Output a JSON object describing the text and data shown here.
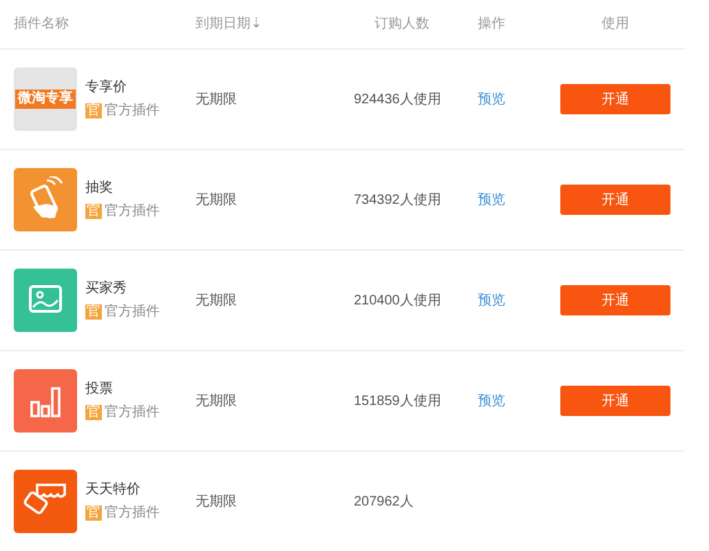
{
  "columns": [
    {
      "label": "插件名称"
    },
    {
      "label": "到期日期",
      "sort_arrow": "⇣"
    },
    {
      "label": "订购人数"
    },
    {
      "label": "操作"
    },
    {
      "label": "使用"
    }
  ],
  "rows": [
    {
      "kind": "banner",
      "banner_text": "微淘专享",
      "name": "专享价",
      "tag": "官",
      "tag_label": "官方插件",
      "expiry": "无期限",
      "count": "924436人使用",
      "preview": "预览",
      "action": "开通"
    },
    {
      "kind": "hand",
      "name": "抽奖",
      "tag": "官",
      "tag_label": "官方插件",
      "expiry": "无期限",
      "count": "734392人使用",
      "preview": "预览",
      "action": "开通"
    },
    {
      "kind": "photo",
      "name": "买家秀",
      "tag": "官",
      "tag_label": "官方插件",
      "expiry": "无期限",
      "count": "210400人使用",
      "preview": "预览",
      "action": "开通"
    },
    {
      "kind": "bars",
      "name": "投票",
      "tag": "官",
      "tag_label": "官方插件",
      "expiry": "无期限",
      "count": "151859人使用",
      "preview": "预览",
      "action": "开通"
    },
    {
      "kind": "shop",
      "name": "天天特价",
      "tag": "官",
      "tag_label": "官方插件",
      "expiry": "无期限",
      "count": "207962人"
    }
  ]
}
